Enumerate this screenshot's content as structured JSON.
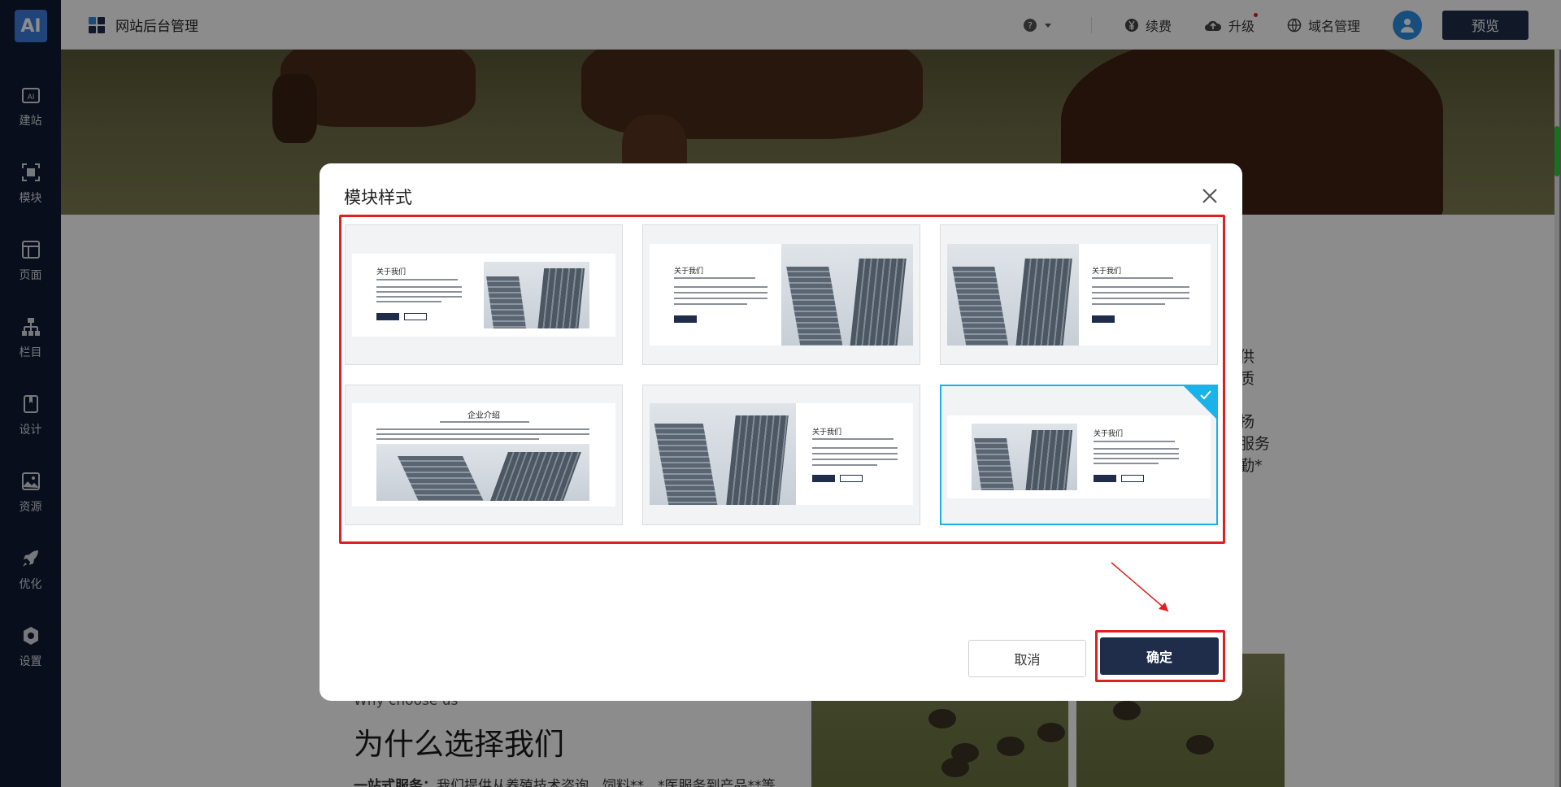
{
  "sidebar": {
    "logo": "AI",
    "items": [
      {
        "label": "建站",
        "icon": "ai-build-icon"
      },
      {
        "label": "模块",
        "icon": "module-icon"
      },
      {
        "label": "页面",
        "icon": "page-icon"
      },
      {
        "label": "栏目",
        "icon": "sitemap-icon"
      },
      {
        "label": "设计",
        "icon": "design-icon"
      },
      {
        "label": "资源",
        "icon": "image-icon"
      },
      {
        "label": "优化",
        "icon": "rocket-icon"
      },
      {
        "label": "设置",
        "icon": "settings-icon"
      }
    ]
  },
  "topbar": {
    "title": "网站后台管理",
    "help": "?",
    "renew": "续费",
    "upgrade": "升级",
    "domain": "域名管理",
    "preview": "预览"
  },
  "background": {
    "side_text_1": "供",
    "side_text_2": "质",
    "side_text_3": "扬",
    "side_text_4": "服务",
    "side_text_5": "勤*",
    "why_sub": "Why choose us",
    "why_title": "为什么选择我们",
    "why_line_bold": "一站式服务：",
    "why_line": "我们提供从养殖技术咨询、饲料**、*医服务到产品**等"
  },
  "modal": {
    "title": "模块样式",
    "cards": [
      {
        "title": "关于我们"
      },
      {
        "title": "关于我们"
      },
      {
        "title": "关于我们"
      },
      {
        "title": "企业介绍"
      },
      {
        "title": "关于我们"
      },
      {
        "title": "关于我们"
      }
    ],
    "selected_index": 5,
    "cancel": "取消",
    "confirm": "确定"
  },
  "colors": {
    "sidebar": "#0f1a33",
    "primary": "#1f2d4a",
    "selected": "#1ab2e8",
    "highlight": "#e02020"
  }
}
